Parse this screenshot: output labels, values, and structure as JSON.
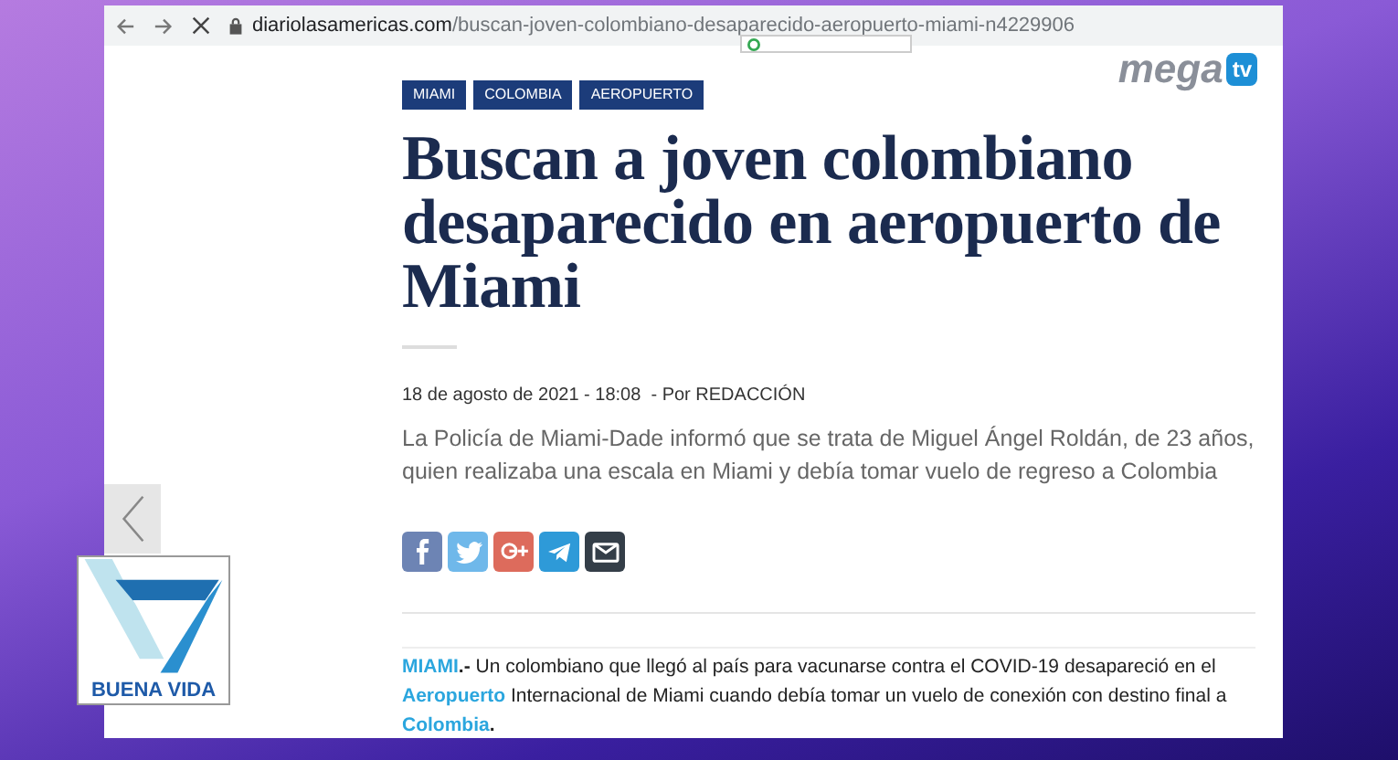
{
  "browser": {
    "url_domain": "diariolasamericas.com",
    "url_path": "/buscan-joven-colombiano-desaparecido-aeropuerto-miami-n4229906",
    "loading": true
  },
  "channel_logo": {
    "word": "mega",
    "badge": "tv"
  },
  "tags": [
    "MIAMI",
    "COLOMBIA",
    "AEROPUERTO"
  ],
  "headline_lines": [
    "Buscan a joven colombiano",
    "desaparecido en aeropuerto de",
    "Miami"
  ],
  "byline": "18 de agosto de 2021 - 18:08  - Por REDACCIÓN",
  "lede": "La Policía de Miami-Dade informó que se trata de Miguel Ángel Roldán, de 23 años, quien realizaba una escala en Miami y debía tomar vuelo de regreso a Colombia",
  "share": [
    {
      "kind": "facebook",
      "color": "#6d84b4"
    },
    {
      "kind": "twitter",
      "color": "#6fb8ea"
    },
    {
      "kind": "googleplus",
      "color": "#dd6b5c"
    },
    {
      "kind": "telegram",
      "color": "#2e9ad8"
    },
    {
      "kind": "email",
      "color": "#343e48"
    }
  ],
  "body": [
    {
      "kind": "link",
      "text": "MIAMI"
    },
    {
      "kind": "bold",
      "text": ".-"
    },
    {
      "kind": "text",
      "text": " Un colombiano que llegó al país para vacunarse contra el COVID-19 desapareció en el "
    },
    {
      "kind": "link",
      "text": "Aeropuerto"
    },
    {
      "kind": "text",
      "text": " Internacional de Miami cuando debía tomar un vuelo de conexión con destino final a "
    },
    {
      "kind": "link",
      "text": "Colombia"
    },
    {
      "kind": "bold",
      "text": "."
    }
  ],
  "show_logo": {
    "name": "BUENA VIDA"
  }
}
